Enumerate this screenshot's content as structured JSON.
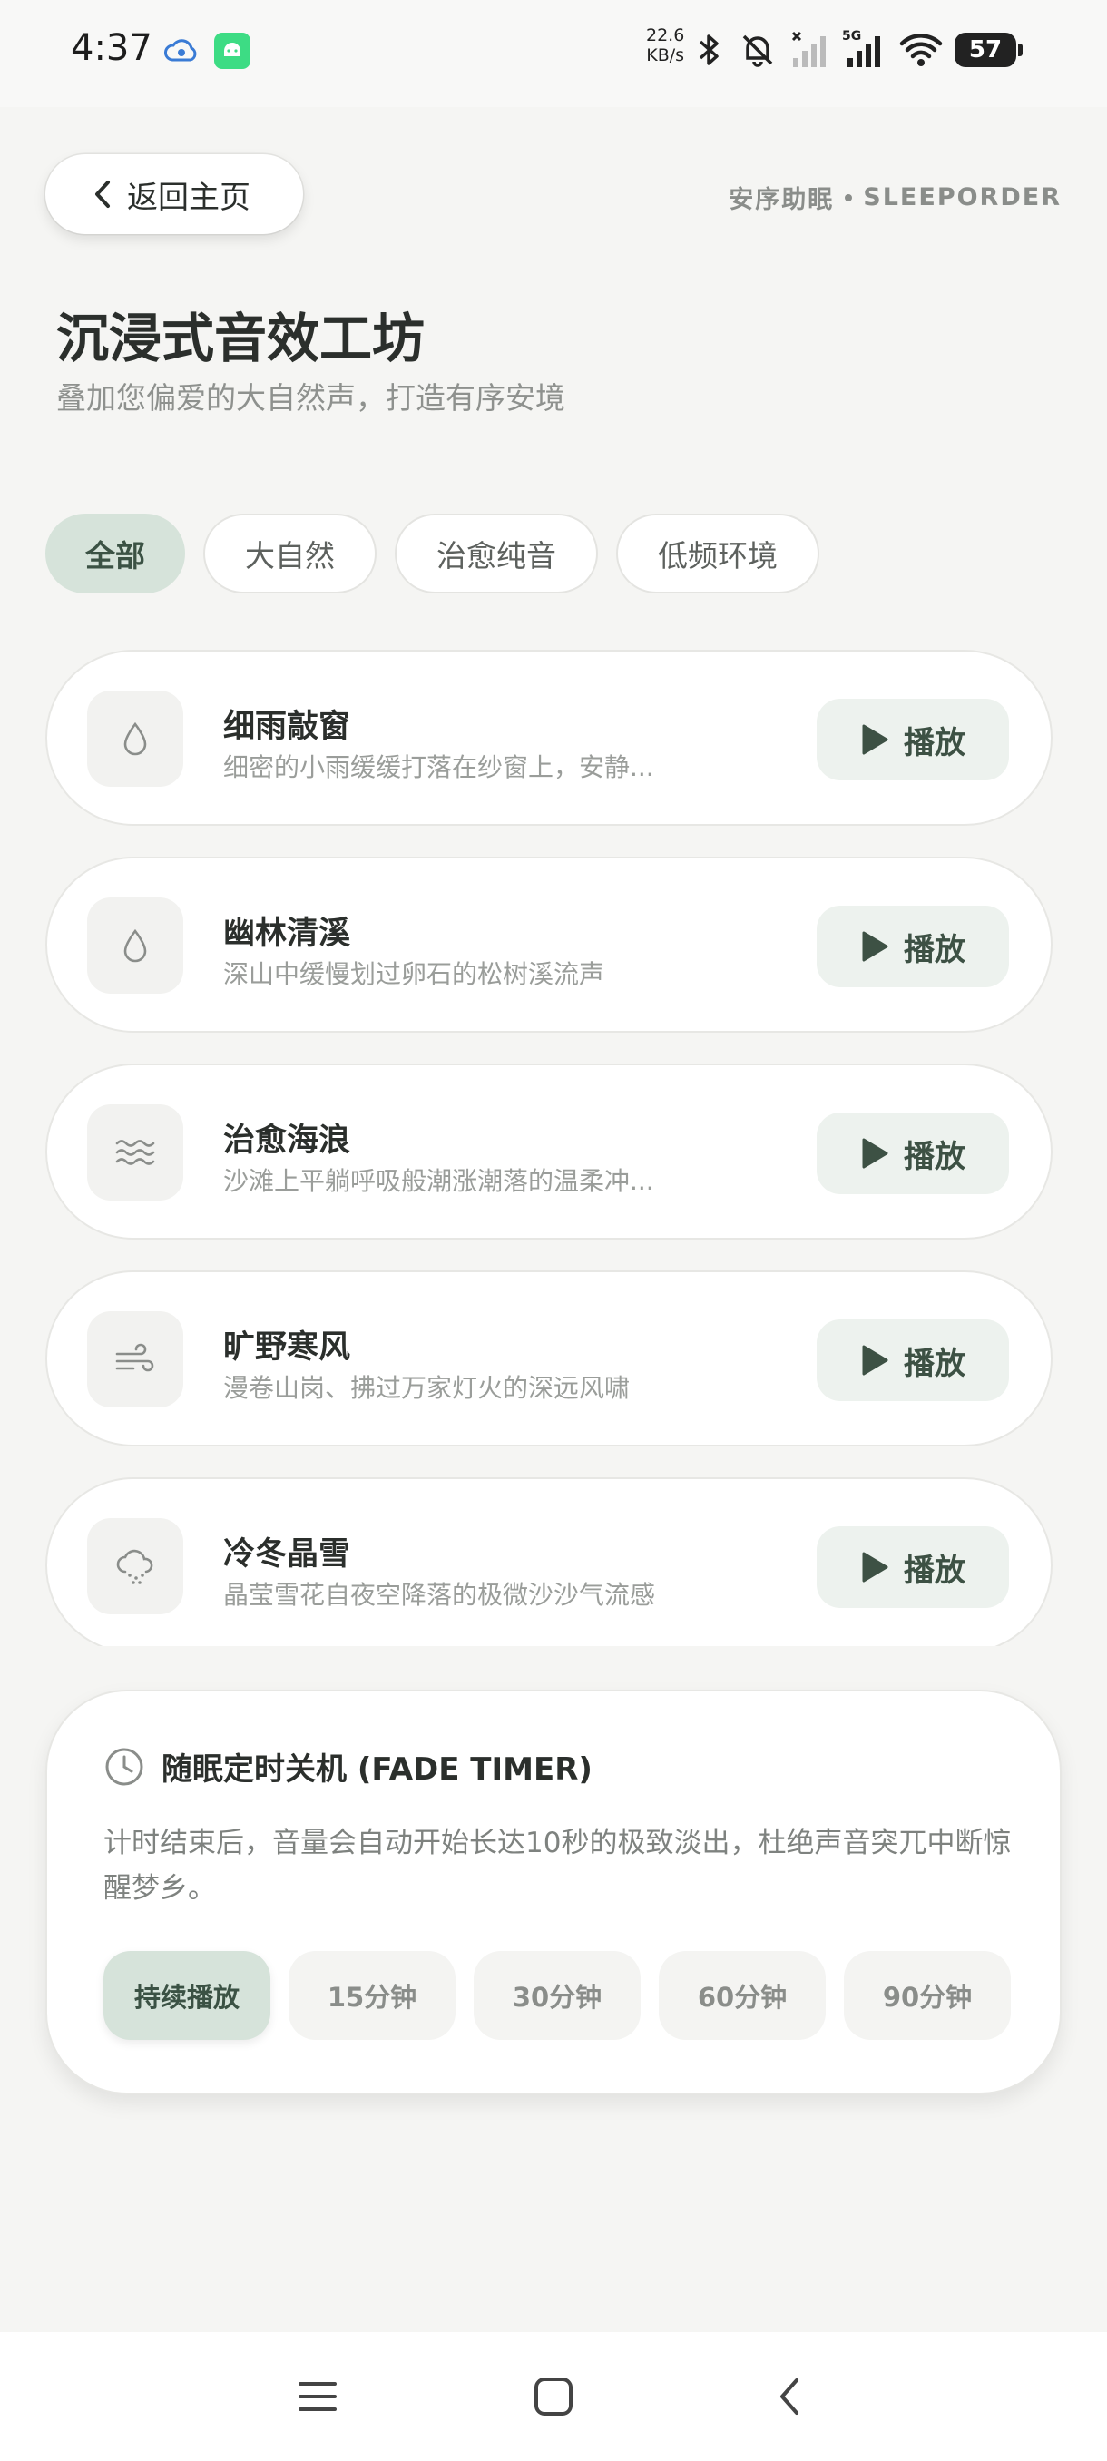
{
  "status_bar": {
    "time": "4:37",
    "net_speed_value": "22.6",
    "net_speed_unit": "KB/s",
    "network": "5G",
    "battery": "57"
  },
  "header": {
    "back_label": "返回主页",
    "brand_cn": "安序助眠",
    "brand_en": "SLEEPORDER",
    "title": "沉浸式音效工坊",
    "subtitle": "叠加您偏爱的大自然声，打造有序安境"
  },
  "filters": [
    {
      "label": "全部",
      "active": true
    },
    {
      "label": "大自然",
      "active": false
    },
    {
      "label": "治愈纯音",
      "active": false
    },
    {
      "label": "低频环境",
      "active": false
    }
  ],
  "sounds": [
    {
      "name": "细雨敲窗",
      "desc": "细密的小雨缓缓打落在纱窗上，安静...",
      "icon": "drop-icon",
      "play_label": "播放"
    },
    {
      "name": "幽林清溪",
      "desc": "深山中缓慢划过卵石的松树溪流声",
      "icon": "drop-icon",
      "play_label": "播放"
    },
    {
      "name": "治愈海浪",
      "desc": "沙滩上平躺呼吸般潮涨潮落的温柔冲...",
      "icon": "waves-icon",
      "play_label": "播放"
    },
    {
      "name": "旷野寒风",
      "desc": "漫卷山岗、拂过万家灯火的深远风啸",
      "icon": "wind-icon",
      "play_label": "播放"
    },
    {
      "name": "冷冬晶雪",
      "desc": "晶莹雪花自夜空降落的极微沙沙气流感",
      "icon": "snow-cloud-icon",
      "play_label": "播放"
    }
  ],
  "timer": {
    "title": "随眠定时关机 (FADE TIMER)",
    "description": "计时结束后，音量会自动开始长达10秒的极致淡出，杜绝声音突兀中断惊醒梦乡。",
    "options": [
      {
        "label": "持续播放",
        "active": true
      },
      {
        "label": "15分钟",
        "active": false
      },
      {
        "label": "30分钟",
        "active": false
      },
      {
        "label": "60分钟",
        "active": false
      },
      {
        "label": "90分钟",
        "active": false
      }
    ]
  },
  "colors": {
    "accent_green": "#3d5144",
    "chip_active_bg": "#d6e3da",
    "play_bg": "#edf2ee",
    "page_bg": "#f5f5f3"
  }
}
